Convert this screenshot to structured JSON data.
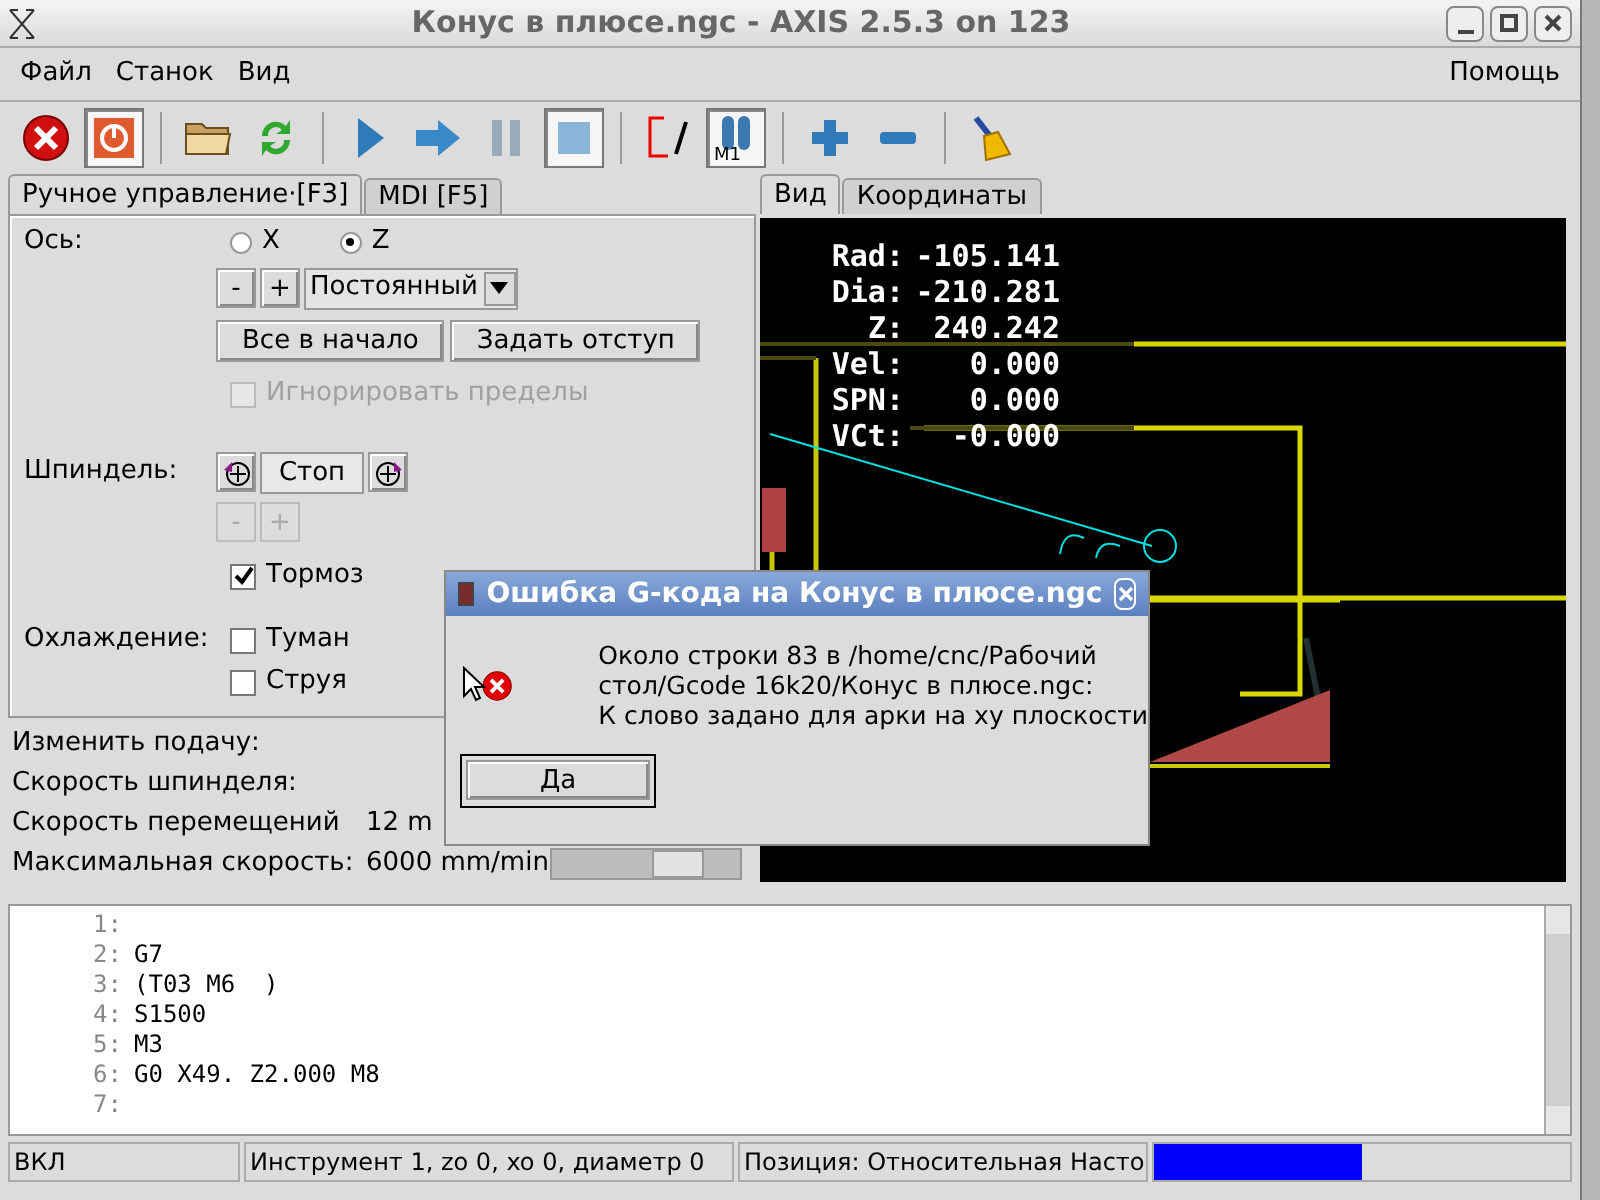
{
  "window": {
    "title": "Конус в плюсе.ngc - AXIS 2.5.3 on 123"
  },
  "menu": {
    "items": [
      "Файл",
      "Станок",
      "Вид"
    ],
    "help": "Помощь"
  },
  "toolbar": [
    {
      "kind": "estop",
      "pressed": false
    },
    {
      "kind": "power",
      "pressed": true
    },
    {
      "kind": "separator"
    },
    {
      "kind": "open",
      "pressed": false
    },
    {
      "kind": "reload",
      "pressed": false
    },
    {
      "kind": "separator"
    },
    {
      "kind": "run",
      "pressed": false
    },
    {
      "kind": "step",
      "pressed": false
    },
    {
      "kind": "pause",
      "pressed": false
    },
    {
      "kind": "stop",
      "pressed": true
    },
    {
      "kind": "separator"
    },
    {
      "kind": "block-delete",
      "pressed": false
    },
    {
      "kind": "optional-stop",
      "pressed": true,
      "label": "M1"
    },
    {
      "kind": "separator"
    },
    {
      "kind": "zoom-in",
      "pressed": false
    },
    {
      "kind": "zoom-out",
      "pressed": false
    },
    {
      "kind": "separator"
    },
    {
      "kind": "clear",
      "pressed": false
    }
  ],
  "left_tabs": [
    {
      "label": "Ручное управление·[F3]",
      "selected": true
    },
    {
      "label": "MDI [F5]",
      "selected": false
    }
  ],
  "axis": {
    "label": "Ось:",
    "options": [
      {
        "label": "X",
        "selected": false
      },
      {
        "label": "Z",
        "selected": true
      }
    ]
  },
  "jog": {
    "minus": "-",
    "plus": "+",
    "mode": "Постоянный"
  },
  "buttons": [
    "Все в начало",
    "Задать отступ"
  ],
  "ignore_limits": {
    "label": "Игнорировать пределы",
    "checked": false,
    "disabled": true
  },
  "spindle": {
    "label": "Шпиндель:",
    "stop": "Стоп",
    "minus": "-",
    "plus": "+",
    "controls_disabled": true
  },
  "brake": {
    "label": "Тормоз",
    "checked": true
  },
  "coolant": {
    "label": "Охлаждение:",
    "items": [
      {
        "label": "Туман",
        "checked": false
      },
      {
        "label": "Струя",
        "checked": false
      }
    ]
  },
  "overrides": [
    {
      "label": "Изменить подачу:"
    },
    {
      "label": "Скорость шпинделя:"
    },
    {
      "label": "Скорость перемещений",
      "value": "12 m"
    },
    {
      "label": "Максимальная скорость:",
      "value": "6000 mm/min",
      "level": 0.72
    }
  ],
  "view_tabs": [
    {
      "label": "Вид",
      "selected": true
    },
    {
      "label": "Координаты",
      "selected": false
    }
  ],
  "dro": [
    {
      "label": "Rad:",
      "value": "-105.141"
    },
    {
      "label": "Dia:",
      "value": "-210.281"
    },
    {
      "label": "Z:",
      "value": "240.242"
    },
    {
      "label": "Vel:",
      "value": "0.000"
    },
    {
      "label": "SPN:",
      "value": "0.000"
    },
    {
      "label": "VCt:",
      "value": "-0.000"
    }
  ],
  "code": [
    {
      "number": "1:"
    },
    {
      "number": "2:",
      "text": "G7"
    },
    {
      "number": "3:",
      "text": "(T03 M6  )"
    },
    {
      "number": "4:",
      "text": "S1500"
    },
    {
      "number": "5:",
      "text": "M3"
    },
    {
      "number": "6:",
      "text": "G0 X49. Z2.000 M8"
    },
    {
      "number": "7:"
    }
  ],
  "status_bar": {
    "fields": [
      "ВКЛ",
      "Инструмент 1, zo 0, xo 0, диаметр 0",
      "Позиция: Относительная Насто"
    ],
    "level": 0.5
  },
  "dialog": {
    "title": "Ошибка G-кода на Конус в плюсе.ngc",
    "message_lines": [
      "Около строки 83 в /home/cnc/Рабочий",
      "стол/Gcode 16k20/Конус в плюсе.ngc:",
      "К слово задано для арки на xy плоскости"
    ],
    "button": "Да"
  }
}
